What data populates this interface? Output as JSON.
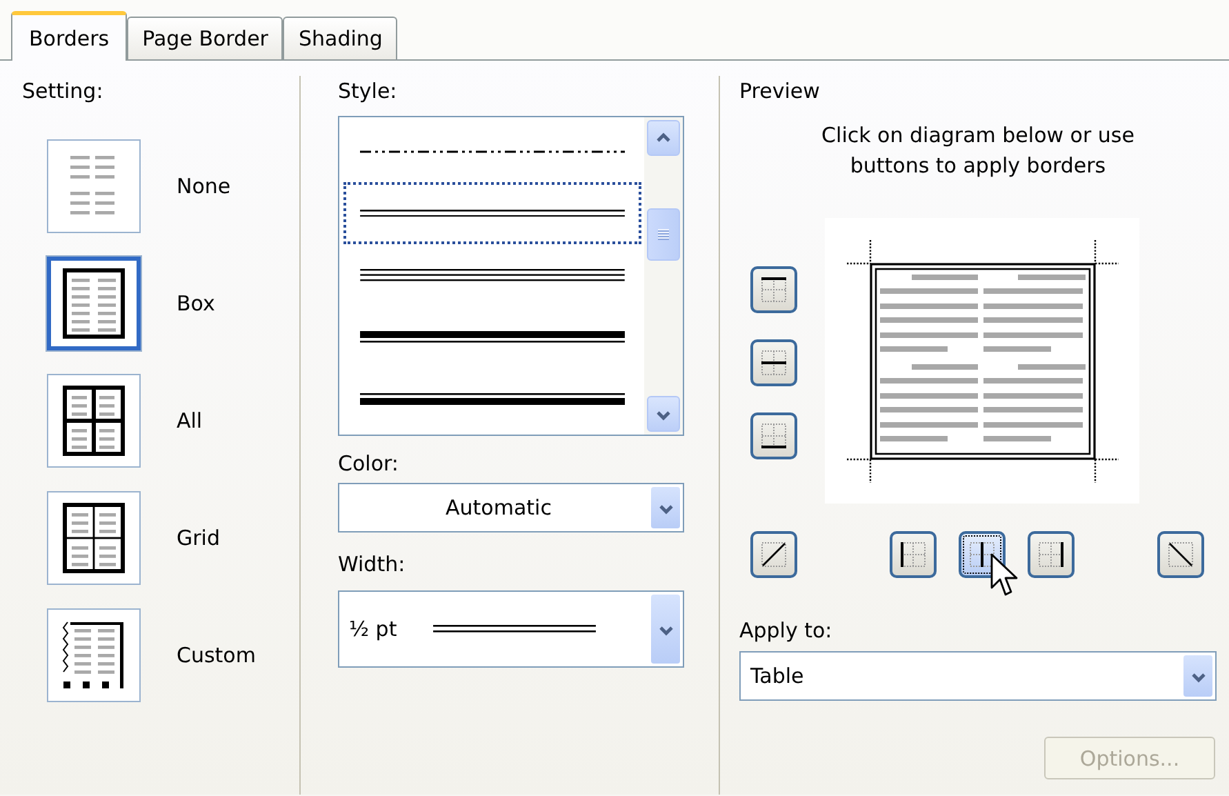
{
  "tabs": [
    {
      "label": "Borders",
      "selected": true
    },
    {
      "label": "Page Border",
      "selected": false
    },
    {
      "label": "Shading",
      "selected": false
    }
  ],
  "setting": {
    "label": "Setting:",
    "options": [
      {
        "kind": "none",
        "label": "None",
        "selected": false
      },
      {
        "kind": "box",
        "label": "Box",
        "selected": true
      },
      {
        "kind": "all",
        "label": "All",
        "selected": false
      },
      {
        "kind": "grid",
        "label": "Grid",
        "selected": false
      },
      {
        "kind": "custom",
        "label": "Custom",
        "selected": false
      }
    ]
  },
  "style": {
    "label": "Style:",
    "items": [
      {
        "kind": "dash-dot-dot",
        "selected": false
      },
      {
        "kind": "double",
        "selected": true
      },
      {
        "kind": "triple",
        "selected": false
      },
      {
        "kind": "thick-thin",
        "selected": false
      },
      {
        "kind": "thin-thick",
        "selected": false
      }
    ]
  },
  "color": {
    "label": "Color:",
    "value": "Automatic"
  },
  "width": {
    "label": "Width:",
    "value": "½ pt"
  },
  "preview": {
    "label": "Preview",
    "hint": "Click on diagram below or use buttons to apply borders",
    "border_buttons": [
      {
        "kind": "top",
        "hovered": false
      },
      {
        "kind": "middle-horizontal",
        "hovered": false
      },
      {
        "kind": "bottom",
        "hovered": false
      },
      {
        "kind": "diagonal-up",
        "hovered": false
      },
      {
        "kind": "left",
        "hovered": false
      },
      {
        "kind": "middle-vertical",
        "hovered": true
      },
      {
        "kind": "right",
        "hovered": false
      },
      {
        "kind": "diagonal-down",
        "hovered": false
      }
    ]
  },
  "apply_to": {
    "label": "Apply to:",
    "value": "Table"
  },
  "options_button": {
    "label": "Options...",
    "disabled": true
  }
}
